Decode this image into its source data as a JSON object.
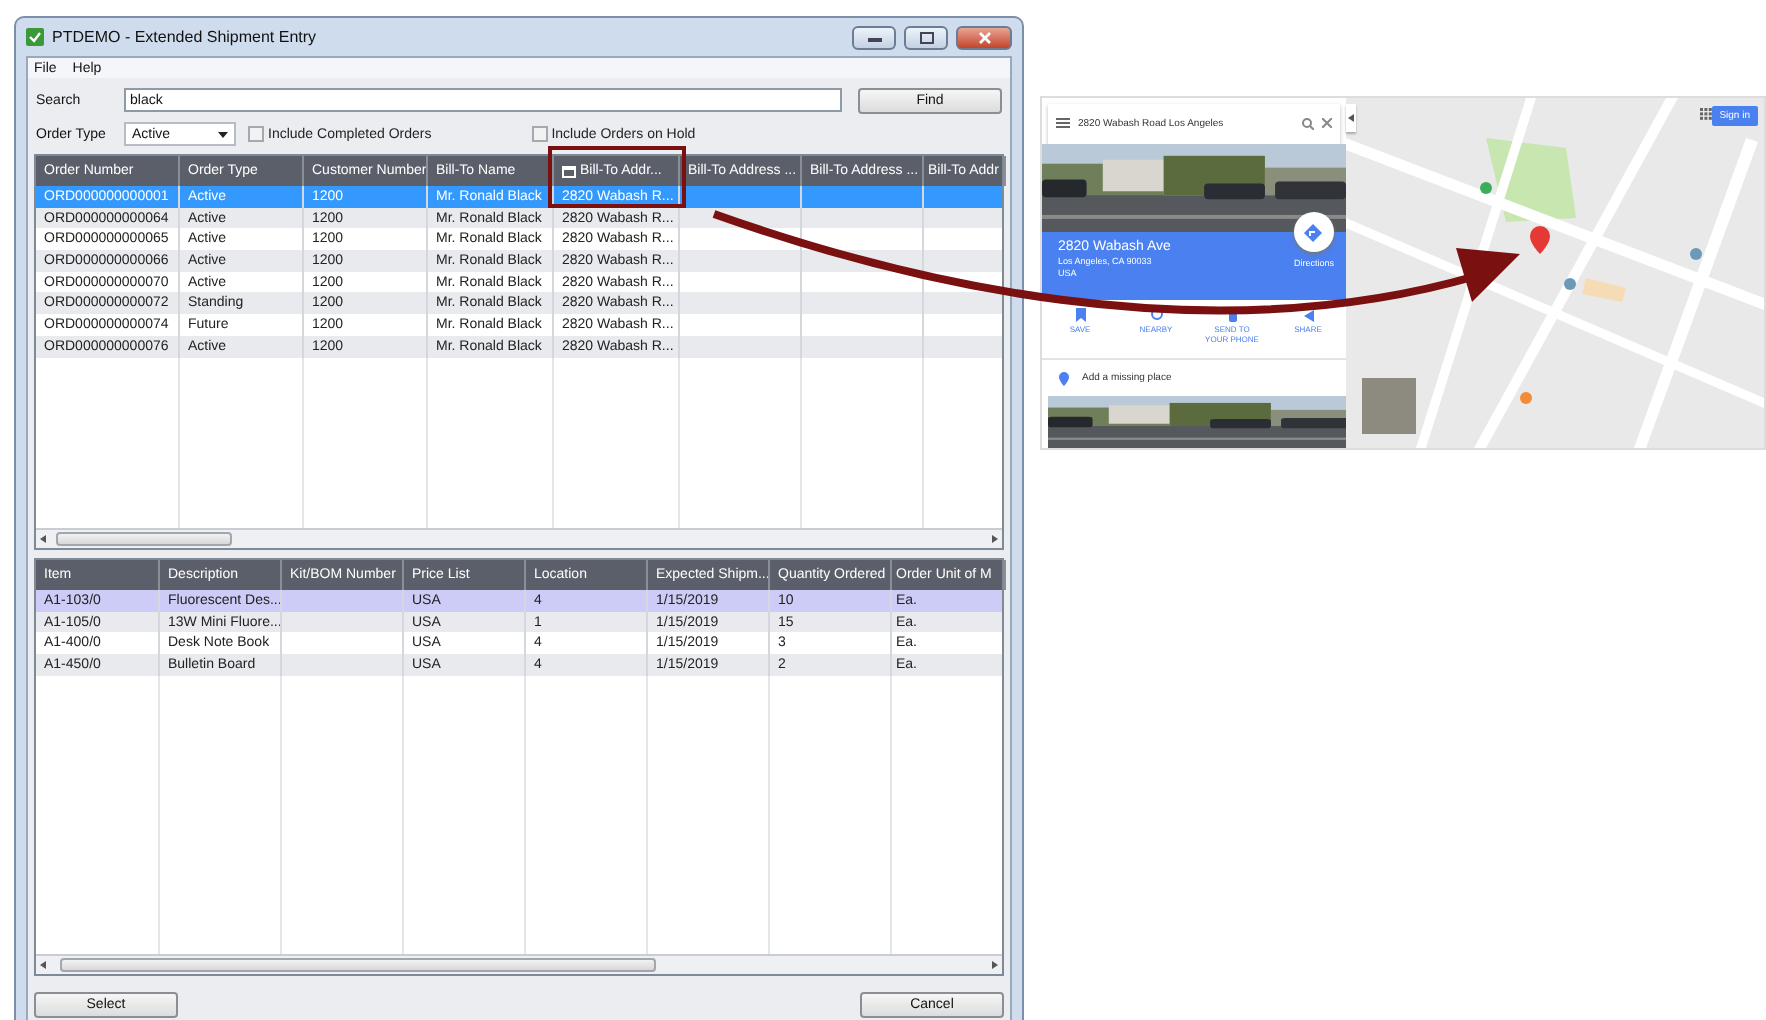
{
  "window": {
    "title": "PTDEMO - Extended Shipment Entry"
  },
  "menu": [
    "File",
    "Help"
  ],
  "search": {
    "label": "Search",
    "value": "black",
    "button": "Find"
  },
  "filters": {
    "order_type_label": "Order Type",
    "order_type": "Active",
    "include_completed": {
      "label": "Include Completed Orders",
      "checked": false
    },
    "include_on_hold": {
      "label": "Include Orders on Hold",
      "checked": false
    }
  },
  "orders": {
    "columns": [
      "Order Number",
      "Order Type",
      "Customer Number",
      "Bill-To Name",
      "Bill-To Addr...",
      "Bill-To Address ...",
      "Bill-To Address ...",
      "Bill-To Addr"
    ],
    "rows": [
      {
        "order_number": "ORD000000000001",
        "order_type": "Active",
        "customer_number": "1200",
        "bill_to_name": "Mr. Ronald Black",
        "bill_to_address": "2820 Wabash R...",
        "selected": true
      },
      {
        "order_number": "ORD000000000064",
        "order_type": "Active",
        "customer_number": "1200",
        "bill_to_name": "Mr. Ronald Black",
        "bill_to_address": "2820 Wabash R...",
        "selected": false
      },
      {
        "order_number": "ORD000000000065",
        "order_type": "Active",
        "customer_number": "1200",
        "bill_to_name": "Mr. Ronald Black",
        "bill_to_address": "2820 Wabash R...",
        "selected": false
      },
      {
        "order_number": "ORD000000000066",
        "order_type": "Active",
        "customer_number": "1200",
        "bill_to_name": "Mr. Ronald Black",
        "bill_to_address": "2820 Wabash R...",
        "selected": false
      },
      {
        "order_number": "ORD000000000070",
        "order_type": "Active",
        "customer_number": "1200",
        "bill_to_name": "Mr. Ronald Black",
        "bill_to_address": "2820 Wabash R...",
        "selected": false
      },
      {
        "order_number": "ORD000000000072",
        "order_type": "Standing",
        "customer_number": "1200",
        "bill_to_name": "Mr. Ronald Black",
        "bill_to_address": "2820 Wabash R...",
        "selected": false
      },
      {
        "order_number": "ORD000000000074",
        "order_type": "Future",
        "customer_number": "1200",
        "bill_to_name": "Mr. Ronald Black",
        "bill_to_address": "2820 Wabash R...",
        "selected": false
      },
      {
        "order_number": "ORD000000000076",
        "order_type": "Active",
        "customer_number": "1200",
        "bill_to_name": "Mr. Ronald Black",
        "bill_to_address": "2820 Wabash R...",
        "selected": false
      }
    ]
  },
  "lines": {
    "columns": [
      "Item",
      "Description",
      "Kit/BOM Number",
      "Price List",
      "Location",
      "Expected Shipm...",
      "Quantity Ordered",
      "Order Unit of M"
    ],
    "rows": [
      {
        "item": "A1-103/0",
        "description": "Fluorescent Des...",
        "price_list": "USA",
        "location": "4",
        "expected_ship": "1/15/2019",
        "quantity": "10",
        "unit": "Ea.",
        "selected": true
      },
      {
        "item": "A1-105/0",
        "description": "13W Mini Fluore...",
        "price_list": "USA",
        "location": "1",
        "expected_ship": "1/15/2019",
        "quantity": "15",
        "unit": "Ea.",
        "selected": false
      },
      {
        "item": "A1-400/0",
        "description": "Desk Note Book",
        "price_list": "USA",
        "location": "4",
        "expected_ship": "1/15/2019",
        "quantity": "3",
        "unit": "Ea.",
        "selected": false
      },
      {
        "item": "A1-450/0",
        "description": "Bulletin Board",
        "price_list": "USA",
        "location": "4",
        "expected_ship": "1/15/2019",
        "quantity": "2",
        "unit": "Ea.",
        "selected": false
      }
    ]
  },
  "buttons": [
    "Select",
    "Cancel"
  ],
  "map": {
    "search": "2820 Wabash Road Los Angeles",
    "place": {
      "name": "2820 Wabash Ave",
      "address": "Los Angeles, CA 90033",
      "country": "USA",
      "directions": "Directions"
    },
    "actions": [
      "SAVE",
      "NEARBY",
      "SEND TO YOUR PHONE",
      "SHARE"
    ],
    "add_place": "Add a missing place",
    "sign_in": "Sign in"
  }
}
